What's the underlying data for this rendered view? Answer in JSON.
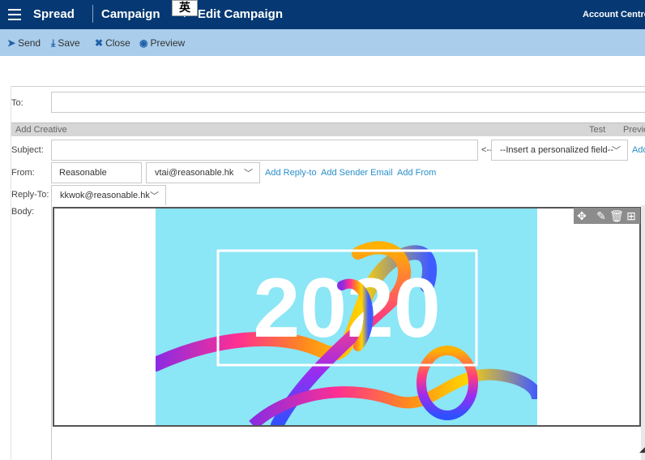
{
  "nav": {
    "brand": "Spread",
    "module": "Campaign",
    "arrow": "▶",
    "page": "Edit Campaign",
    "account": "Account Centre",
    "ime_char": "英"
  },
  "toolbar": {
    "send": "Send",
    "save": "Save",
    "close": "Close",
    "preview": "Preview"
  },
  "form": {
    "to_label": "To:",
    "to_value": "",
    "section_title": "Add Creative",
    "test_label": "Test",
    "preview_label": "Preview",
    "subject_label": "Subject:",
    "subject_value": "",
    "insert_arrow": "<--",
    "personalized_field": "--Insert a personalized field--",
    "add_link": "Add",
    "from_label": "From:",
    "from_name": "Reasonable",
    "from_email": "vtai@reasonable.hk",
    "add_reply_to": "Add Reply-to",
    "add_sender_email": "Add Sender Email",
    "add_from": "Add From",
    "reply_to_label": "Reply-To:",
    "reply_to_email": "kkwok@reasonable.hk",
    "body_label": "Body:"
  },
  "banner": {
    "year_text": "2020",
    "background_color": "#8be6f6"
  },
  "colors": {
    "navbar": "#063973",
    "toolbar": "#a9cdeb",
    "link": "#2a8fc9"
  },
  "icons": [
    "menu-icon",
    "send-icon",
    "save-icon",
    "close-icon",
    "preview-icon",
    "chevron-down-icon",
    "move-icon",
    "edit-icon",
    "delete-icon",
    "add-block-icon"
  ]
}
